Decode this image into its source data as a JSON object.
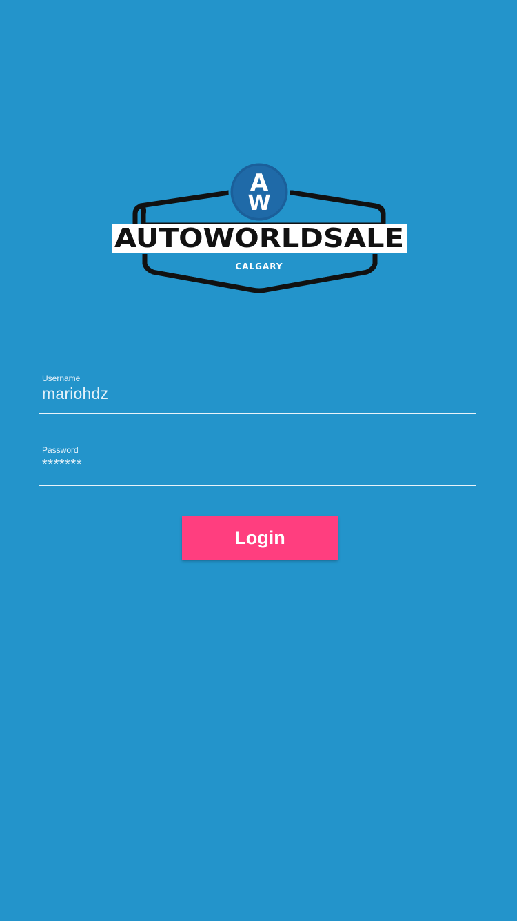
{
  "colors": {
    "background": "#2394cb",
    "button": "#ff3e7f",
    "field_line": "#e8f3fa",
    "logo_outline": "#111111"
  },
  "logo": {
    "monogram_top": "A",
    "monogram_bottom": "W",
    "brand_name": "AUTOWORLDSALE",
    "city": "CALGARY"
  },
  "form": {
    "username": {
      "label": "Username",
      "value": "mariohdz"
    },
    "password": {
      "label": "Password",
      "value": "*******"
    },
    "login_label": "Login"
  }
}
